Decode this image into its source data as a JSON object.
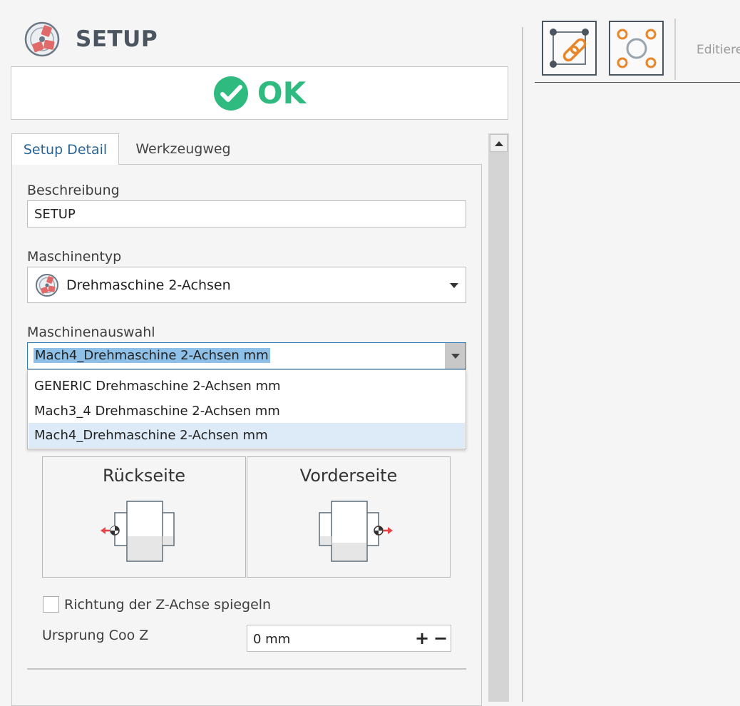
{
  "header": {
    "title": "SETUP",
    "icon": "lathe-chuck-icon"
  },
  "ok_button": {
    "label": "OK",
    "icon": "check-circle-icon",
    "color": "#2fba80"
  },
  "tabs": [
    {
      "label": "Setup Detail",
      "active": true
    },
    {
      "label": "Werkzeugweg",
      "active": false
    }
  ],
  "form": {
    "beschreibung": {
      "label": "Beschreibung",
      "value": "SETUP"
    },
    "maschinentyp": {
      "label": "Maschinentyp",
      "value": "Drehmaschine 2-Achsen",
      "icon": "lathe-chuck-icon"
    },
    "maschinenauswahl": {
      "label": "Maschinenauswahl",
      "value": "Mach4_Drehmaschine 2-Achsen mm",
      "options": [
        "GENERIC Drehmaschine 2-Achsen mm",
        "Mach3_4 Drehmaschine 2-Achsen mm",
        "Mach4_Drehmaschine 2-Achsen mm"
      ],
      "selected_index": 2
    },
    "side_cards": [
      {
        "label": "Rückseite"
      },
      {
        "label": "Vorderseite"
      }
    ],
    "mirror_checkbox": {
      "label": "Richtung der Z-Achse spiegeln",
      "checked": false
    },
    "ursprung": {
      "label": "Ursprung Coo Z",
      "value": "0 mm",
      "plus": "+",
      "minus": "−"
    }
  },
  "toolbar": {
    "buttons": [
      {
        "icon": "link-chain-icon"
      },
      {
        "icon": "circle-points-icon"
      }
    ],
    "edit_label": "Editiere",
    "accent": "#e8862a"
  }
}
